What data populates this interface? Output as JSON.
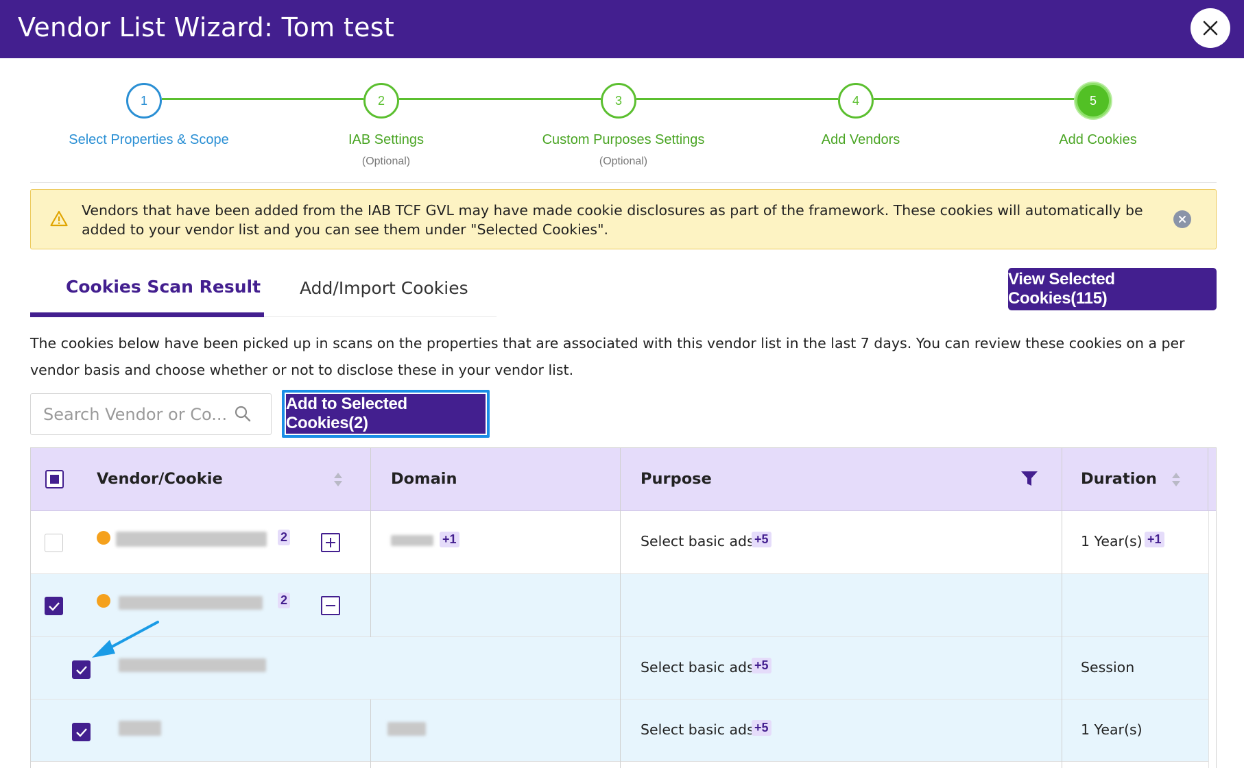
{
  "header": {
    "title": "Vendor List Wizard: Tom test"
  },
  "stepper": {
    "steps": [
      {
        "number": "1",
        "label": "Select Properties & Scope",
        "sub": ""
      },
      {
        "number": "2",
        "label": "IAB Settings",
        "sub": "(Optional)"
      },
      {
        "number": "3",
        "label": "Custom Purposes Settings",
        "sub": "(Optional)"
      },
      {
        "number": "4",
        "label": "Add Vendors",
        "sub": ""
      },
      {
        "number": "5",
        "label": "Add Cookies",
        "sub": ""
      }
    ]
  },
  "alert": {
    "text": "Vendors that have been added from the IAB TCF GVL may have made cookie disclosures as part of the framework. These cookies will automatically be added to your vendor list and you can see them under \"Selected Cookies\"."
  },
  "tabs": {
    "active": "Cookies Scan Result",
    "inactive": "Add/Import Cookies"
  },
  "view_button": "View Selected Cookies(115)",
  "description": "The cookies below have been picked up in scans on the properties that are associated with this vendor list in the last 7 days. You can review these cookies on a per vendor basis and choose whether or not to disclose these in your vendor list.",
  "search": {
    "placeholder": "Search Vendor or Co...",
    "value": ""
  },
  "add_button": "Add to Selected Cookies(2)",
  "table": {
    "columns": [
      "Vendor/Cookie",
      "Domain",
      "Purpose",
      "Duration"
    ],
    "rows": [
      {
        "vendor_count": "2",
        "domain_extra": "+1",
        "purpose": "Select basic ads",
        "purpose_extra": "+5",
        "duration": "1 Year(s)",
        "duration_extra": "+1"
      },
      {
        "vendor_count": "2"
      },
      {
        "purpose": "Select basic ads",
        "purpose_extra": "+5",
        "duration": "Session"
      },
      {
        "purpose": "Select basic ads",
        "purpose_extra": "+5",
        "duration": "1 Year(s)"
      }
    ]
  },
  "colors": {
    "brand": "#431f8f",
    "step_green": "#5bbf2f",
    "step_blue": "#2a8fd4",
    "alert_bg": "#fdf3c3",
    "vendor_dot": "#f5a11d",
    "highlight_blue": "#1a8ee6"
  }
}
